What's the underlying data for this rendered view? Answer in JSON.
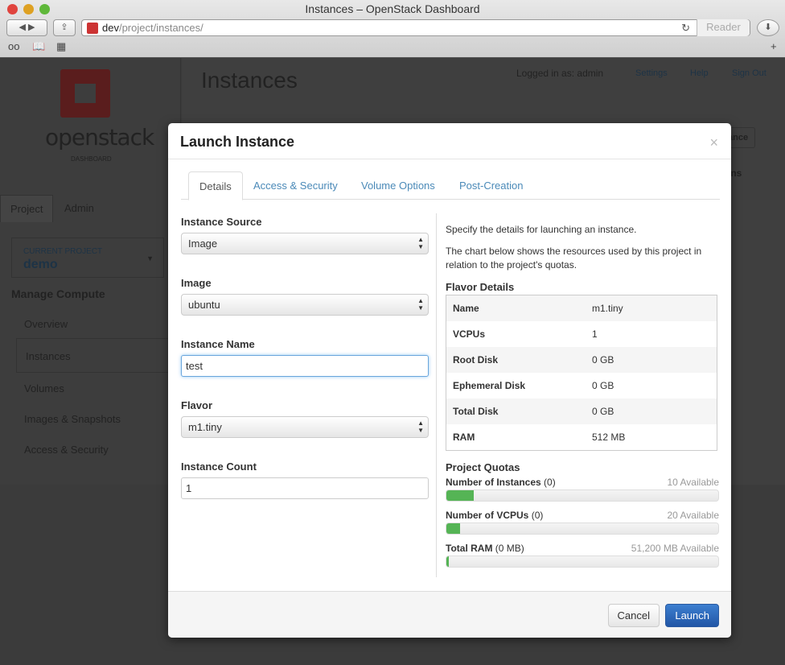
{
  "browser": {
    "title": "Instances – OpenStack Dashboard",
    "url_host": "dev",
    "url_path": "/project/instances/",
    "reader": "Reader"
  },
  "sidebar": {
    "brand": "openstack",
    "brand_sub": "DASHBOARD",
    "tabs": [
      "Project",
      "Admin"
    ],
    "current_project_label": "CURRENT PROJECT",
    "current_project": "demo",
    "section": "Manage Compute",
    "items": [
      "Overview",
      "Instances",
      "Volumes",
      "Images & Snapshots",
      "Access & Security"
    ]
  },
  "page": {
    "title": "Instances",
    "logged_in": "Logged in as: admin",
    "settings": "Settings",
    "help": "Help",
    "sign_out": "Sign Out",
    "launch_partial": "ance",
    "actions_partial": "ons"
  },
  "modal": {
    "title": "Launch Instance",
    "close": "×",
    "tabs": [
      "Details",
      "Access & Security",
      "Volume Options",
      "Post-Creation"
    ],
    "fields": {
      "source_label": "Instance Source",
      "source": "Image",
      "image_label": "Image",
      "image": "ubuntu",
      "name_label": "Instance Name",
      "name": "test",
      "flavor_label": "Flavor",
      "flavor": "m1.tiny",
      "count_label": "Instance Count",
      "count": "1"
    },
    "help1": "Specify the details for launching an instance.",
    "help2": "The chart below shows the resources used by this project in relation to the project's quotas.",
    "flavor_title": "Flavor Details",
    "flavor": [
      [
        "Name",
        "m1.tiny"
      ],
      [
        "VCPUs",
        "1"
      ],
      [
        "Root Disk",
        "0 GB"
      ],
      [
        "Ephemeral Disk",
        "0 GB"
      ],
      [
        "Total Disk",
        "0 GB"
      ],
      [
        "RAM",
        "512 MB"
      ]
    ],
    "quota_title": "Project Quotas",
    "quotas": [
      {
        "label": "Number of Instances",
        "used": "(0)",
        "avail": "10 Available",
        "percent": 10
      },
      {
        "label": "Number of VCPUs",
        "used": "(0)",
        "avail": "20 Available",
        "percent": 5
      },
      {
        "label": "Total RAM",
        "used": "(0 MB)",
        "avail": "51,200 MB Available",
        "percent": 1
      }
    ],
    "cancel": "Cancel",
    "launch": "Launch"
  }
}
